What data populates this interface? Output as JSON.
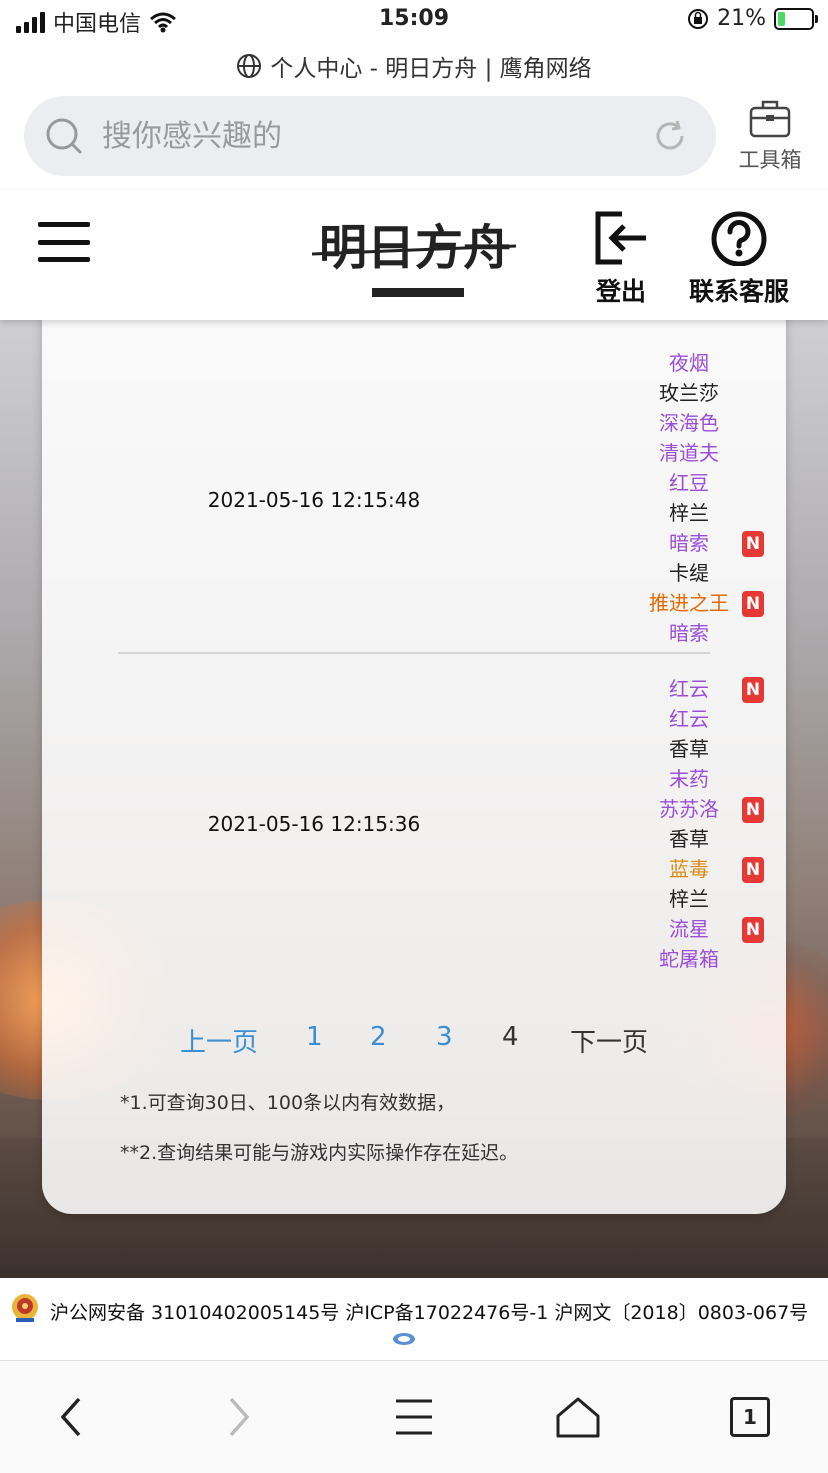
{
  "status_bar": {
    "carrier": "中国电信",
    "time": "15:09",
    "battery_percent": "21%",
    "battery_level": 0.21
  },
  "browser": {
    "page_title": "个人中心 - 明日方舟 | 鹰角网络",
    "search_placeholder": "搜你感兴趣的",
    "toolbox_label": "工具箱",
    "tab_count": "1"
  },
  "site_header": {
    "logout_label": "登出",
    "service_label": "联系客服",
    "logo_alt": "明日方舟"
  },
  "colors": {
    "accent_link": "#3b8fd1",
    "rarity_6": "#e66a00",
    "rarity_5": "#d88a12",
    "rarity_4": "#9b4fd8",
    "rarity_3": "#222222",
    "new_badge": "#e53935"
  },
  "records": [
    {
      "time": "2021-05-16 12:15:48",
      "items": [
        {
          "name": "夜烟",
          "rarity": 4,
          "new": false
        },
        {
          "name": "玫兰莎",
          "rarity": 3,
          "new": false
        },
        {
          "name": "深海色",
          "rarity": 4,
          "new": false
        },
        {
          "name": "清道夫",
          "rarity": 4,
          "new": false
        },
        {
          "name": "红豆",
          "rarity": 4,
          "new": false
        },
        {
          "name": "梓兰",
          "rarity": 3,
          "new": false
        },
        {
          "name": "暗索",
          "rarity": 4,
          "new": true
        },
        {
          "name": "卡缇",
          "rarity": 3,
          "new": false
        },
        {
          "name": "推进之王",
          "rarity": 6,
          "new": true
        },
        {
          "name": "暗索",
          "rarity": 4,
          "new": false
        }
      ]
    },
    {
      "time": "2021-05-16 12:15:36",
      "items": [
        {
          "name": "红云",
          "rarity": 4,
          "new": true
        },
        {
          "name": "红云",
          "rarity": 4,
          "new": false
        },
        {
          "name": "香草",
          "rarity": 3,
          "new": false
        },
        {
          "name": "末药",
          "rarity": 4,
          "new": false
        },
        {
          "name": "苏苏洛",
          "rarity": 4,
          "new": true
        },
        {
          "name": "香草",
          "rarity": 3,
          "new": false
        },
        {
          "name": "蓝毒",
          "rarity": 5,
          "new": true
        },
        {
          "name": "梓兰",
          "rarity": 3,
          "new": false
        },
        {
          "name": "流星",
          "rarity": 4,
          "new": true
        },
        {
          "name": "蛇屠箱",
          "rarity": 4,
          "new": false
        }
      ]
    }
  ],
  "new_badge_label": "N",
  "pagination": {
    "prev": "上一页",
    "pages": [
      "1",
      "2",
      "3",
      "4"
    ],
    "current": "4",
    "next": "下一页"
  },
  "notes": [
    "*1.可查询30日、100条以内有效数据，",
    "**2.查询结果可能与游戏内实际操作存在延迟。"
  ],
  "footer": {
    "text": "沪公网安备 31010402005145号  沪ICP备17022476号-1  沪网文〔2018〕0803-067号"
  }
}
